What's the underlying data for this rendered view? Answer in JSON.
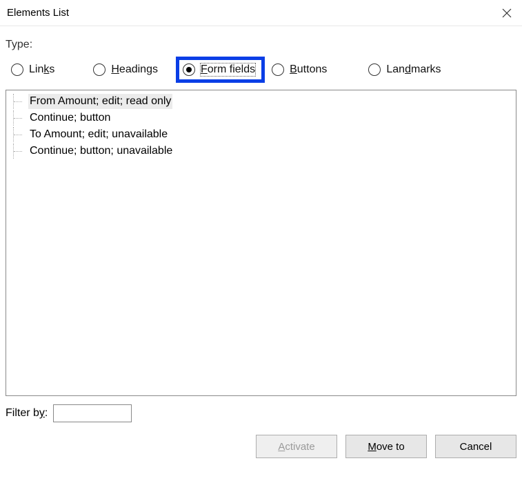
{
  "titlebar": {
    "title": "Elements List"
  },
  "type_group": {
    "legend": "Type:",
    "options": {
      "links": {
        "pre": "Lin",
        "ul": "k",
        "post": "s",
        "checked": false
      },
      "headings": {
        "pre": "",
        "ul": "H",
        "post": "eadings",
        "checked": false
      },
      "formfields": {
        "pre": "",
        "ul": "F",
        "post": "orm fields",
        "checked": true
      },
      "buttons": {
        "pre": "",
        "ul": "B",
        "post": "uttons",
        "checked": false
      },
      "landmarks": {
        "pre": "Lan",
        "ul": "d",
        "post": "marks",
        "checked": false
      }
    }
  },
  "list": {
    "items": [
      "From Amount; edit; read only",
      "Continue; button",
      "To Amount; edit; unavailable",
      "Continue; button; unavailable"
    ],
    "selected_index": 0
  },
  "filter": {
    "label_pre": "Filter b",
    "label_ul": "y",
    "label_post": ":",
    "value": ""
  },
  "buttons": {
    "activate": {
      "pre": "",
      "ul": "A",
      "post": "ctivate",
      "disabled": true
    },
    "moveto": {
      "pre": "",
      "ul": "M",
      "post": "ove to",
      "disabled": false
    },
    "cancel": {
      "text": "Cancel",
      "disabled": false
    }
  }
}
